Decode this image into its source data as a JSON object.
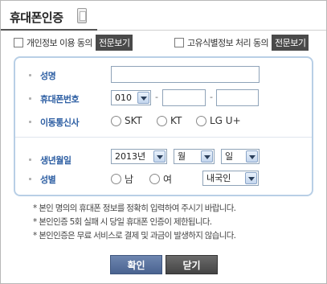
{
  "header": {
    "title": "휴대폰인증",
    "icon": "mobile-phone-icon"
  },
  "agreements": [
    {
      "label": "개인정보 이용 동의",
      "button": "전문보기"
    },
    {
      "label": "고유식별정보 처리 동의",
      "button": "전문보기"
    }
  ],
  "form": {
    "name_label": "성명",
    "phone_label": "휴대폰번호",
    "phone_prefix": "010",
    "carrier_label": "이동통신사",
    "carriers": [
      "SKT",
      "KT",
      "LG U+"
    ],
    "birth_label": "생년월일",
    "birth_year": "2013년",
    "birth_month": "월",
    "birth_day": "일",
    "gender_label": "성별",
    "genders": [
      "남",
      "여"
    ],
    "nationality": "내국인",
    "dash": "-"
  },
  "notes": [
    "* 본인 명의의 휴대폰 정보를 정확히 입력하여 주시기 바랍니다.",
    "* 본인인증 5회 실패 시 당일 휴대폰 인증이 제한됩니다.",
    "* 본인인증은 무료 서비스로 결제 및 과금이 발생하지 않습니다."
  ],
  "buttons": {
    "confirm": "확인",
    "close": "닫기"
  },
  "colors": {
    "label_blue": "#2e5fa3",
    "form_border": "#b8cfe6",
    "confirm_bg": "#5a73a0",
    "close_bg": "#555555"
  }
}
